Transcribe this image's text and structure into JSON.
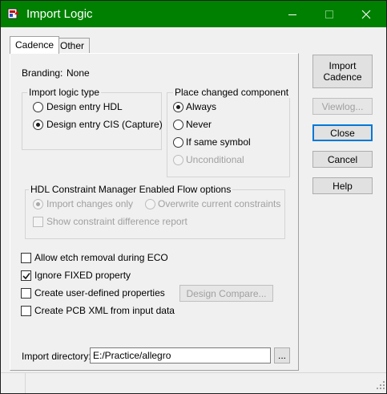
{
  "window": {
    "title": "Import Logic",
    "titlebar_color": "#008000",
    "title_icon": "import-logic-app-icon",
    "controls": {
      "minimize": "minimize-icon",
      "maximize": "maximize-icon",
      "close": "close-icon"
    }
  },
  "tabs": [
    {
      "label": "Cadence",
      "selected": true
    },
    {
      "label": "Other",
      "selected": false
    }
  ],
  "branding": {
    "label": "Branding:",
    "value": "None"
  },
  "import_logic_type": {
    "title": "Import logic type",
    "options": [
      {
        "label": "Design entry HDL",
        "checked": false
      },
      {
        "label": "Design entry CIS (Capture)",
        "checked": true
      }
    ]
  },
  "place_changed": {
    "title": "Place changed component",
    "options": [
      {
        "label": "Always",
        "checked": true,
        "enabled": true
      },
      {
        "label": "Never",
        "checked": false,
        "enabled": true
      },
      {
        "label": "If same symbol",
        "checked": false,
        "enabled": true
      },
      {
        "label": "Unconditional",
        "checked": false,
        "enabled": false
      }
    ]
  },
  "hdl_flow": {
    "title": "HDL Constraint Manager Enabled Flow options",
    "import_changes_only": "Import changes only",
    "overwrite_constraints": "Overwrite current constraints",
    "show_diff_report": "Show constraint difference report"
  },
  "options": {
    "allow_etch_removal": {
      "label": "Allow etch removal during ECO",
      "checked": false
    },
    "ignore_fixed": {
      "label": "Ignore FIXED property",
      "checked": true
    },
    "create_user_props": {
      "label": "Create user-defined properties",
      "checked": false
    },
    "create_pcb_xml": {
      "label": "Create PCB XML from input data",
      "checked": false
    }
  },
  "design_compare_label": "Design Compare...",
  "import_directory": {
    "label": "Import directory:",
    "value": "E:/Practice/allegro",
    "browse_label": "..."
  },
  "side_buttons": {
    "import_cadence": "Import\nCadence",
    "viewlog": "Viewlog...",
    "close": "Close",
    "cancel": "Cancel",
    "help": "Help"
  }
}
